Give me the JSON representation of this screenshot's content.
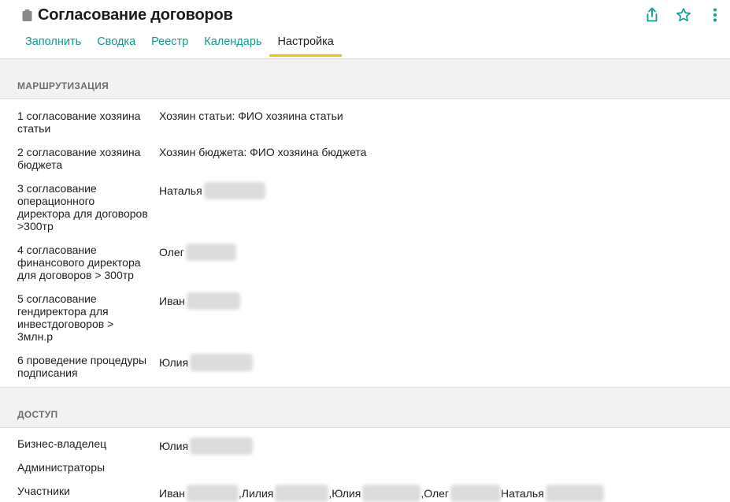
{
  "header": {
    "title": "Согласование договоров",
    "icons": [
      "clipboard-icon",
      "share-icon",
      "star-icon",
      "more-vert-icon"
    ],
    "accent_color": "#0f9b8e",
    "active_tab_underline": "#f3c200"
  },
  "tabs": [
    {
      "label": "Заполнить",
      "active": false
    },
    {
      "label": "Сводка",
      "active": false
    },
    {
      "label": "Реестр",
      "active": false
    },
    {
      "label": "Календарь",
      "active": false
    },
    {
      "label": "Настройка",
      "active": true
    }
  ],
  "routing": {
    "title": "МАРШРУТИЗАЦИЯ",
    "rows": [
      {
        "label": "1 согласование хозяина статьи",
        "value": "Хозяин статьи: ФИО хозяина статьи"
      },
      {
        "label": "2 согласование хозяина бюджета",
        "value": "Хозяин бюджета: ФИО хозяина бюджета"
      },
      {
        "label": "3 согласование операционного директора для договоров >300тр",
        "value": "Наталья"
      },
      {
        "label": "4 согласование финансового директора для договоров > 300тр",
        "value": "Олег"
      },
      {
        "label": "5 согласование гендиректора для инвестдоговоров > 3млн.р",
        "value": "Иван"
      },
      {
        "label": "6 проведение процедуры подписания",
        "value": "Юлия"
      }
    ]
  },
  "access": {
    "title": "ДОСТУП",
    "business_owner": {
      "label": "Бизнес-владелец",
      "value": "Юлия"
    },
    "admins": {
      "label": "Администраторы",
      "value": ""
    },
    "members": {
      "label": "Участники",
      "names": [
        "Иван",
        "Лилия",
        "Юлия",
        "Олег",
        "Наталья"
      ]
    }
  }
}
